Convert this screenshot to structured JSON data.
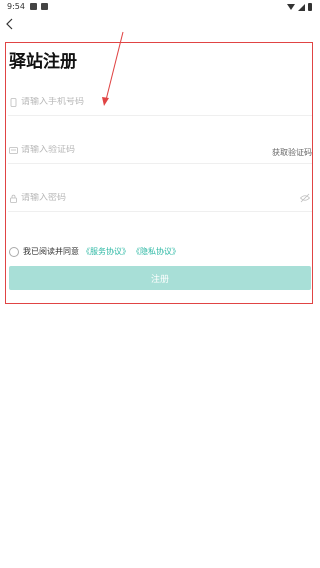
{
  "status_bar": {
    "time": "9:54"
  },
  "header": {
    "back_icon": "chevron-left-icon",
    "title": "驿站注册"
  },
  "form": {
    "phone": {
      "placeholder": "请输入手机号码",
      "icon": "phone-icon"
    },
    "code": {
      "placeholder": "请输入验证码",
      "icon": "message-icon",
      "get_code_label": "获取验证码"
    },
    "password": {
      "placeholder": "请输入密码",
      "icon": "lock-icon",
      "toggle_icon": "eye-icon"
    }
  },
  "agreement": {
    "prefix": "我已阅读并同意",
    "service_link": "《服务协议》",
    "privacy_link": "《隐私协议》"
  },
  "submit_label": "注册",
  "colors": {
    "accent": "#2cb8a4",
    "button_bg": "#a8dfd7",
    "annotation": "#e04444"
  }
}
